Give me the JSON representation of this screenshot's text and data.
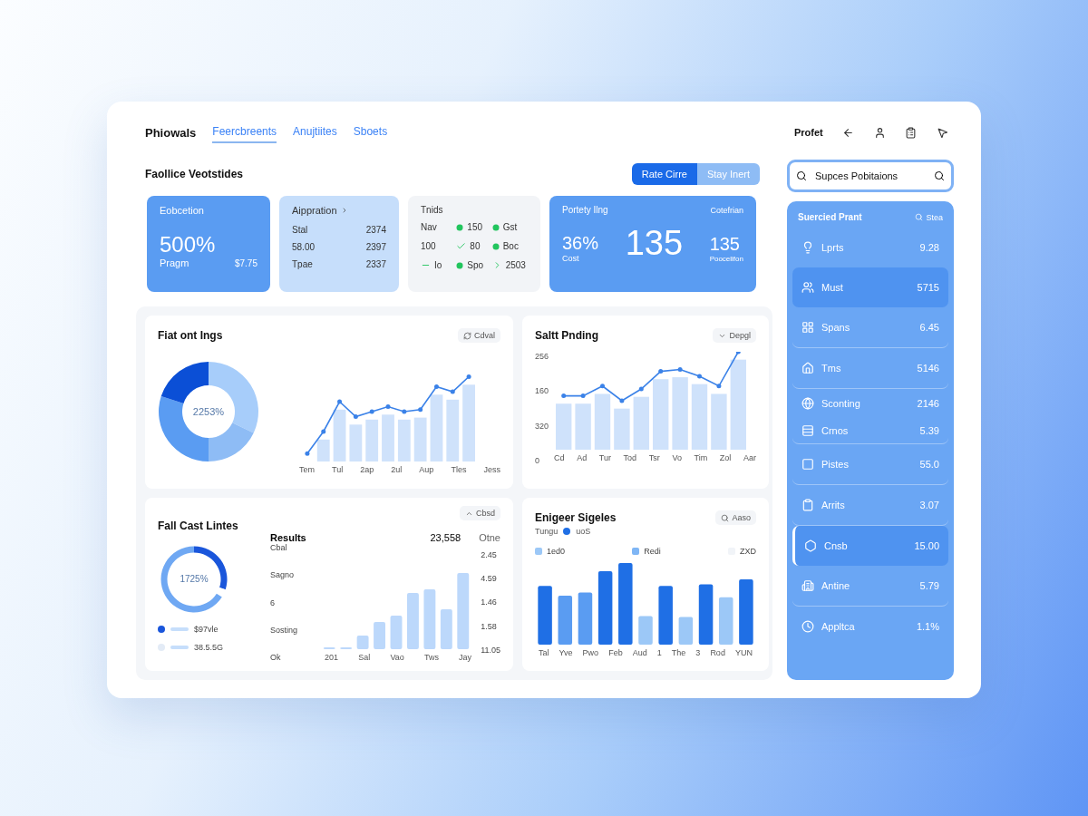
{
  "nav": {
    "brand": "Phiowals",
    "tabs": [
      {
        "label": "Feercbreents",
        "selected": true
      },
      {
        "label": "Anujtiites",
        "selected": false
      },
      {
        "label": "Sboets",
        "selected": false
      }
    ]
  },
  "header": {
    "title": "Faollice Veotstides",
    "segments": [
      {
        "label": "Rate Cirre",
        "selected": true
      },
      {
        "label": "Stay Inert",
        "selected": false
      }
    ]
  },
  "stats": [
    {
      "kind": "big",
      "title": "Eobcetion",
      "value": "500%",
      "label": "Pragm",
      "amount": "$7.75"
    },
    {
      "kind": "list",
      "title": "Aippration",
      "rows": [
        [
          "Stal",
          "2374"
        ],
        [
          "58.00",
          "2397"
        ],
        [
          "Tpae",
          "2337"
        ]
      ]
    },
    {
      "kind": "grid",
      "title": "Tnids",
      "rows": [
        [
          "Nav",
          "150",
          "Gst"
        ],
        [
          "100",
          "80",
          "Boc"
        ],
        [
          "Io",
          "Spo",
          "2503"
        ]
      ]
    },
    {
      "kind": "wide",
      "title": "Portety Ilng",
      "subtitle": "Cotefrian",
      "small": "36%",
      "small_label": "Cost",
      "value": "135",
      "side": "135",
      "side_label": "Poocelifon"
    }
  ],
  "panels": [
    {
      "kind": "donut_line",
      "title": "Fiat ont Ings",
      "action": "Cdval",
      "center": "2253%",
      "x_labels": [
        "Tem",
        "Tul",
        "2ap",
        "2ul",
        "Aup",
        "Tles",
        "Jess"
      ]
    },
    {
      "kind": "combo",
      "title": "Saltt Pnding",
      "action": "Depgl",
      "y_labels": [
        "256",
        "160",
        "320",
        "0"
      ],
      "x_labels": [
        "Cd",
        "Ad",
        "Tur",
        "Tod",
        "Tsr",
        "Vo",
        "Tim",
        "Zol",
        "Aar"
      ]
    },
    {
      "kind": "ring_bars",
      "title": "Fall Cast Lintes",
      "action": "Cbsd",
      "center": "1725%",
      "legend": [
        {
          "label": "$97vle",
          "color": "#1a56db"
        },
        {
          "label": "38.5.5G",
          "color": "#e3ebf6"
        }
      ],
      "results": "Results",
      "total": "23,558",
      "unit": "Otne",
      "left_labels": [
        "Cbal",
        "Sagno",
        "6",
        "Sosting",
        "Ok"
      ],
      "right_labels": [
        "2.45",
        "4.59",
        "1.46",
        "1.58",
        "11.05"
      ],
      "x_labels": [
        "201",
        "Sal",
        "Vao",
        "Tws",
        "Jay"
      ]
    },
    {
      "kind": "bars",
      "title": "Enigeer Sigeles",
      "action": "Aaso",
      "series_label": "Tungu",
      "series": {
        "label": "uoS",
        "color": "#1f6fe5"
      },
      "legend": [
        {
          "label": "1ed0",
          "color": "#9cc8f7"
        },
        {
          "label": "Redi",
          "color": "#7fb6f5"
        },
        {
          "label": "ZXD",
          "color": "#f1f4f8"
        }
      ],
      "x_labels": [
        "Tal",
        "Yve",
        "Pwo",
        "Feb",
        "Aud",
        "1",
        "The",
        "3",
        "Rod",
        "YUN"
      ]
    }
  ],
  "profile": {
    "label": "Profet"
  },
  "search": {
    "value": "Supces Pobitaions"
  },
  "list": {
    "title": "Suercied Prant",
    "action": "Stea",
    "items": [
      {
        "label": "Lprts",
        "value": "9.28",
        "selected": false
      },
      {
        "label": "Must",
        "value": "5715",
        "selected": true
      },
      {
        "label": "Spans",
        "value": "6.45",
        "selected": false
      },
      {
        "label": "Tms",
        "value": "5146",
        "selected": false
      },
      {
        "label": "Sconting",
        "value": "2146",
        "selected": false
      },
      {
        "label": "Crnos",
        "value": "5.39",
        "selected": false
      },
      {
        "label": "Pistes",
        "value": "55.0",
        "selected": false
      },
      {
        "label": "Arrits",
        "value": "3.07",
        "selected": false
      },
      {
        "label": "Cnsb",
        "value": "15.00",
        "selected": true
      },
      {
        "label": "Antine",
        "value": "5.79",
        "selected": false
      },
      {
        "label": "Appltca",
        "value": "1.1%",
        "selected": false
      }
    ]
  }
}
